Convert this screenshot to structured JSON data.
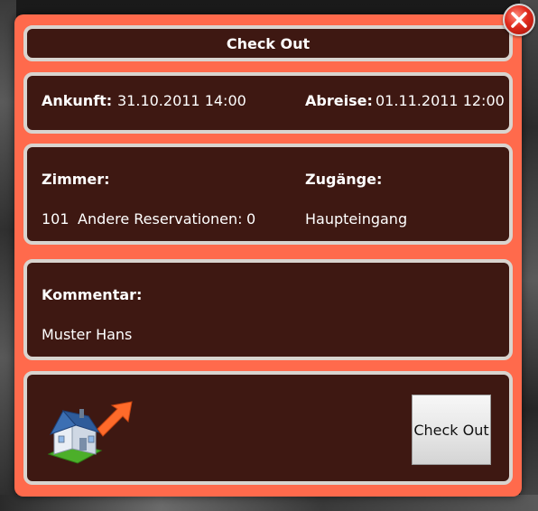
{
  "dialog": {
    "title": "Check Out"
  },
  "dates": {
    "arrival_label": "Ankunft:",
    "arrival_value": "31.10.2011 14:00",
    "departure_label": "Abreise:",
    "departure_value": "01.11.2011 12:00"
  },
  "room": {
    "room_label": "Zimmer:",
    "room_number": "101",
    "other_reservations_label": "Andere Reservationen:",
    "other_reservations_value": "0",
    "access_label": "Zugänge:",
    "access_value": "Haupteingang"
  },
  "comment": {
    "label": "Kommentar:",
    "value": "Muster Hans"
  },
  "actions": {
    "checkout_button_label": "Check Out",
    "icon": "house-checkout-icon"
  },
  "icons": {
    "close": "close-icon"
  },
  "colors": {
    "dialog_background": "#ff6a4c",
    "panel_background": "#3e1812",
    "panel_border": "#d9d4cf",
    "close_button": "#e02a1c"
  }
}
